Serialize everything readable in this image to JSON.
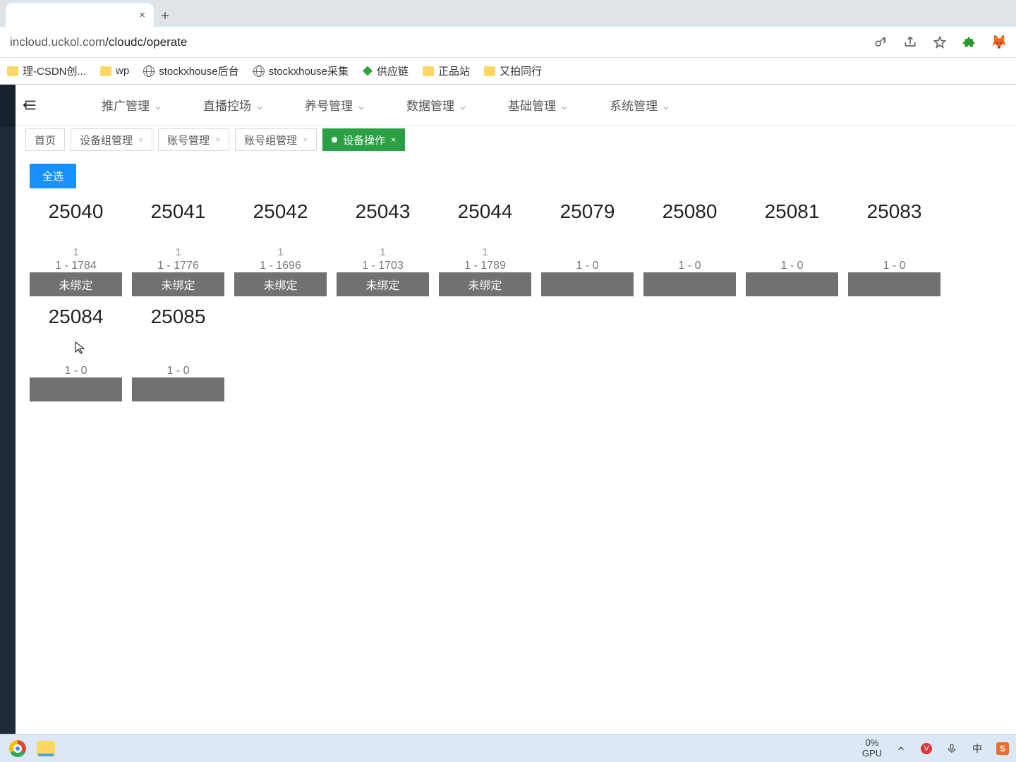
{
  "browser": {
    "url_host": "incloud.uckol.com",
    "url_path": "/cloudc/operate",
    "bookmarks": [
      {
        "icon": "folder",
        "label": "理-CSDN创..."
      },
      {
        "icon": "folder",
        "label": "wp"
      },
      {
        "icon": "globe",
        "label": "stockxhouse后台"
      },
      {
        "icon": "globe",
        "label": "stockxhouse采集"
      },
      {
        "icon": "leaf",
        "label": "供应链"
      },
      {
        "icon": "folder",
        "label": "正品站"
      },
      {
        "icon": "folder",
        "label": "又拍同行"
      }
    ]
  },
  "nav": [
    {
      "label": "推广管理"
    },
    {
      "label": "直播控场"
    },
    {
      "label": "养号管理"
    },
    {
      "label": "数据管理"
    },
    {
      "label": "基础管理"
    },
    {
      "label": "系统管理"
    }
  ],
  "pagetabs": [
    {
      "label": "首页",
      "closable": false
    },
    {
      "label": "设备组管理",
      "closable": true
    },
    {
      "label": "账号管理",
      "closable": true
    },
    {
      "label": "账号组管理",
      "closable": true
    },
    {
      "label": "设备操作",
      "closable": true,
      "active": true
    }
  ],
  "select_all": "全选",
  "devices": [
    {
      "id": "25040",
      "count": "1",
      "range": "1 - 1784",
      "status": "未绑定"
    },
    {
      "id": "25041",
      "count": "1",
      "range": "1 - 1776",
      "status": "未绑定"
    },
    {
      "id": "25042",
      "count": "1",
      "range": "1 - 1696",
      "status": "未绑定"
    },
    {
      "id": "25043",
      "count": "1",
      "range": "1 - 1703",
      "status": "未绑定"
    },
    {
      "id": "25044",
      "count": "1",
      "range": "1 - 1789",
      "status": "未绑定"
    },
    {
      "id": "25079",
      "count": "",
      "range": "1 - 0",
      "status": ""
    },
    {
      "id": "25080",
      "count": "",
      "range": "1 - 0",
      "status": ""
    },
    {
      "id": "25081",
      "count": "",
      "range": "1 - 0",
      "status": ""
    },
    {
      "id": "25083",
      "count": "",
      "range": "1 - 0",
      "status": ""
    },
    {
      "id": "25084",
      "count": "",
      "range": "1 - 0",
      "status": ""
    },
    {
      "id": "25085",
      "count": "",
      "range": "1 - 0",
      "status": ""
    }
  ],
  "gpu": {
    "pct": "0%",
    "label": "GPU"
  },
  "ime": "中"
}
